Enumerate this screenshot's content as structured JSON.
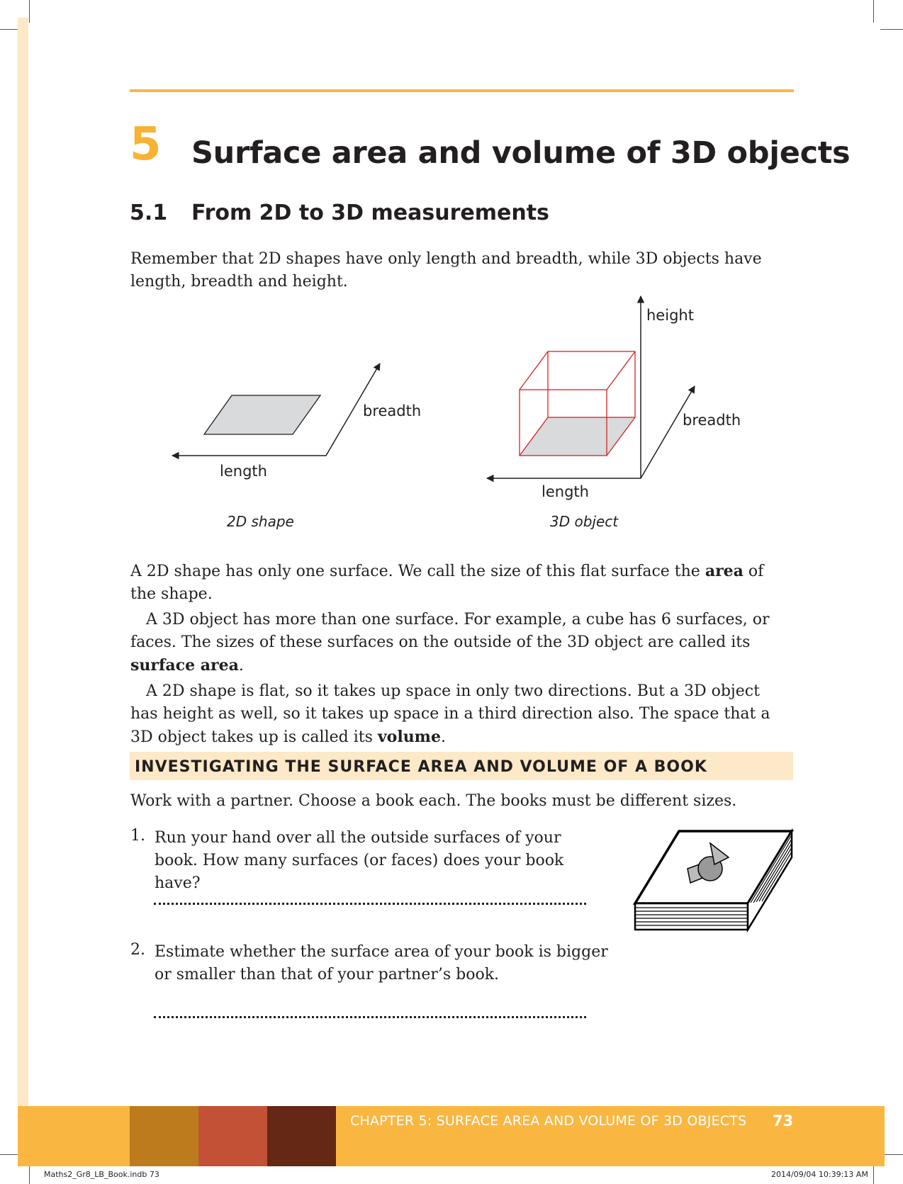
{
  "chapter": {
    "number": "5",
    "title": "Surface area and volume of 3D objects"
  },
  "section": {
    "number": "5.1",
    "title": "From 2D to 3D measurements"
  },
  "intro": "Remember that 2D shapes have only length and breadth, while 3D objects have length, breadth and height.",
  "diagram": {
    "shape2d": {
      "breadth": "breadth",
      "length": "length",
      "caption": "2D shape"
    },
    "object3d": {
      "height": "height",
      "breadth": "breadth",
      "length": "length",
      "caption": "3D object"
    },
    "colors": {
      "face": "#d9dadb",
      "cube_edges": "#d2232a",
      "lines": "#231f20"
    }
  },
  "body": {
    "p1_a": "A 2D shape has only one surface. We call the size of this flat surface the ",
    "p1_b": "area",
    "p1_c": " of the shape.",
    "p2_a": "A 3D object has more than one surface. For example, a cube has 6 surfaces, or faces. The sizes of these surfaces on the outside of the 3D object are called its ",
    "p2_b": "surface area",
    "p2_c": ".",
    "p3_a": "A 2D shape is flat, so it takes up space in only two directions. But a 3D object has height as well, so it takes up space in a third direction also. The space that a 3D object takes up is called its ",
    "p3_b": "volume",
    "p3_c": "."
  },
  "investigation": {
    "title": "INVESTIGATING THE SURFACE AREA AND VOLUME OF A BOOK",
    "instruction": "Work with a partner. Choose a book each. The books must be different sizes.",
    "questions": [
      {
        "num": "1.",
        "text": "Run your hand over all the outside surfaces of your book. How many surfaces (or faces) does your book have?"
      },
      {
        "num": "2.",
        "text": "Estimate whether the surface area of your book is bigger or smaller than that of your partner’s book."
      }
    ]
  },
  "footer": {
    "chapter_label": "CHAPTER 5: SURFACE AREA AND VOLUME OF 3D OBJECTS",
    "page_number": "73",
    "swatches": [
      "#bc7c1e",
      "#c25135",
      "#652815"
    ],
    "bar_color": "#f9b741"
  },
  "slug": {
    "file": "Maths2_Gr8_LB_Book.indb   73",
    "timestamp": "2014/09/04   10:39:13 AM"
  }
}
